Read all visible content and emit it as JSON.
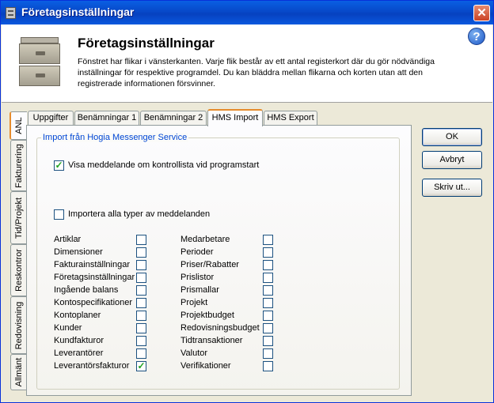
{
  "window": {
    "title": "Företagsinställningar",
    "close_glyph": "✕"
  },
  "header": {
    "title": "Företagsinställningar",
    "description": "Fönstret har flikar i vänsterkanten. Varje flik består av ett antal registerkort där du gör nödvändiga inställningar för respektive programdel. Du kan bläddra mellan flikarna och korten utan att den registrerade informationen försvinner.",
    "help_glyph": "?"
  },
  "vertical_tabs": [
    "ANL",
    "Fakturering",
    "Tid/Projekt",
    "Reskontror",
    "Redovisning",
    "Allmänt"
  ],
  "tabs": [
    "Uppgifter",
    "Benämningar 1",
    "Benämningar 2",
    "HMS Import",
    "HMS Export"
  ],
  "group": {
    "label": "Import från Hogia Messenger Service",
    "show_checklist_label": "Visa meddelande om kontrollista vid programstart",
    "show_checklist_checked": true,
    "import_all_label": "Importera alla typer av meddelanden",
    "import_all_checked": false
  },
  "items_left": [
    {
      "label": "Artiklar",
      "checked": false
    },
    {
      "label": "Dimensioner",
      "checked": false
    },
    {
      "label": "Fakturainställningar",
      "checked": false
    },
    {
      "label": "Företagsinställningar",
      "checked": false
    },
    {
      "label": "Ingående balans",
      "checked": false
    },
    {
      "label": "Kontospecifikationer",
      "checked": false
    },
    {
      "label": "Kontoplaner",
      "checked": false
    },
    {
      "label": "Kunder",
      "checked": false
    },
    {
      "label": "Kundfakturor",
      "checked": false
    },
    {
      "label": "Leverantörer",
      "checked": false
    },
    {
      "label": "Leverantörsfakturor",
      "checked": true
    }
  ],
  "items_right": [
    {
      "label": "Medarbetare",
      "checked": false
    },
    {
      "label": "Perioder",
      "checked": false
    },
    {
      "label": "Priser/Rabatter",
      "checked": false
    },
    {
      "label": "Prislistor",
      "checked": false
    },
    {
      "label": "Prismallar",
      "checked": false
    },
    {
      "label": "Projekt",
      "checked": false
    },
    {
      "label": "Projektbudget",
      "checked": false
    },
    {
      "label": "Redovisningsbudget",
      "checked": false
    },
    {
      "label": "Tidtransaktioner",
      "checked": false
    },
    {
      "label": "Valutor",
      "checked": false
    },
    {
      "label": "Verifikationer",
      "checked": false
    }
  ],
  "buttons": {
    "ok": "OK",
    "cancel": "Avbryt",
    "print": "Skriv ut..."
  },
  "colors": {
    "titlebar": "#0A5FE3",
    "tab_highlight": "#E68B2C",
    "group_label": "#0046D5"
  }
}
